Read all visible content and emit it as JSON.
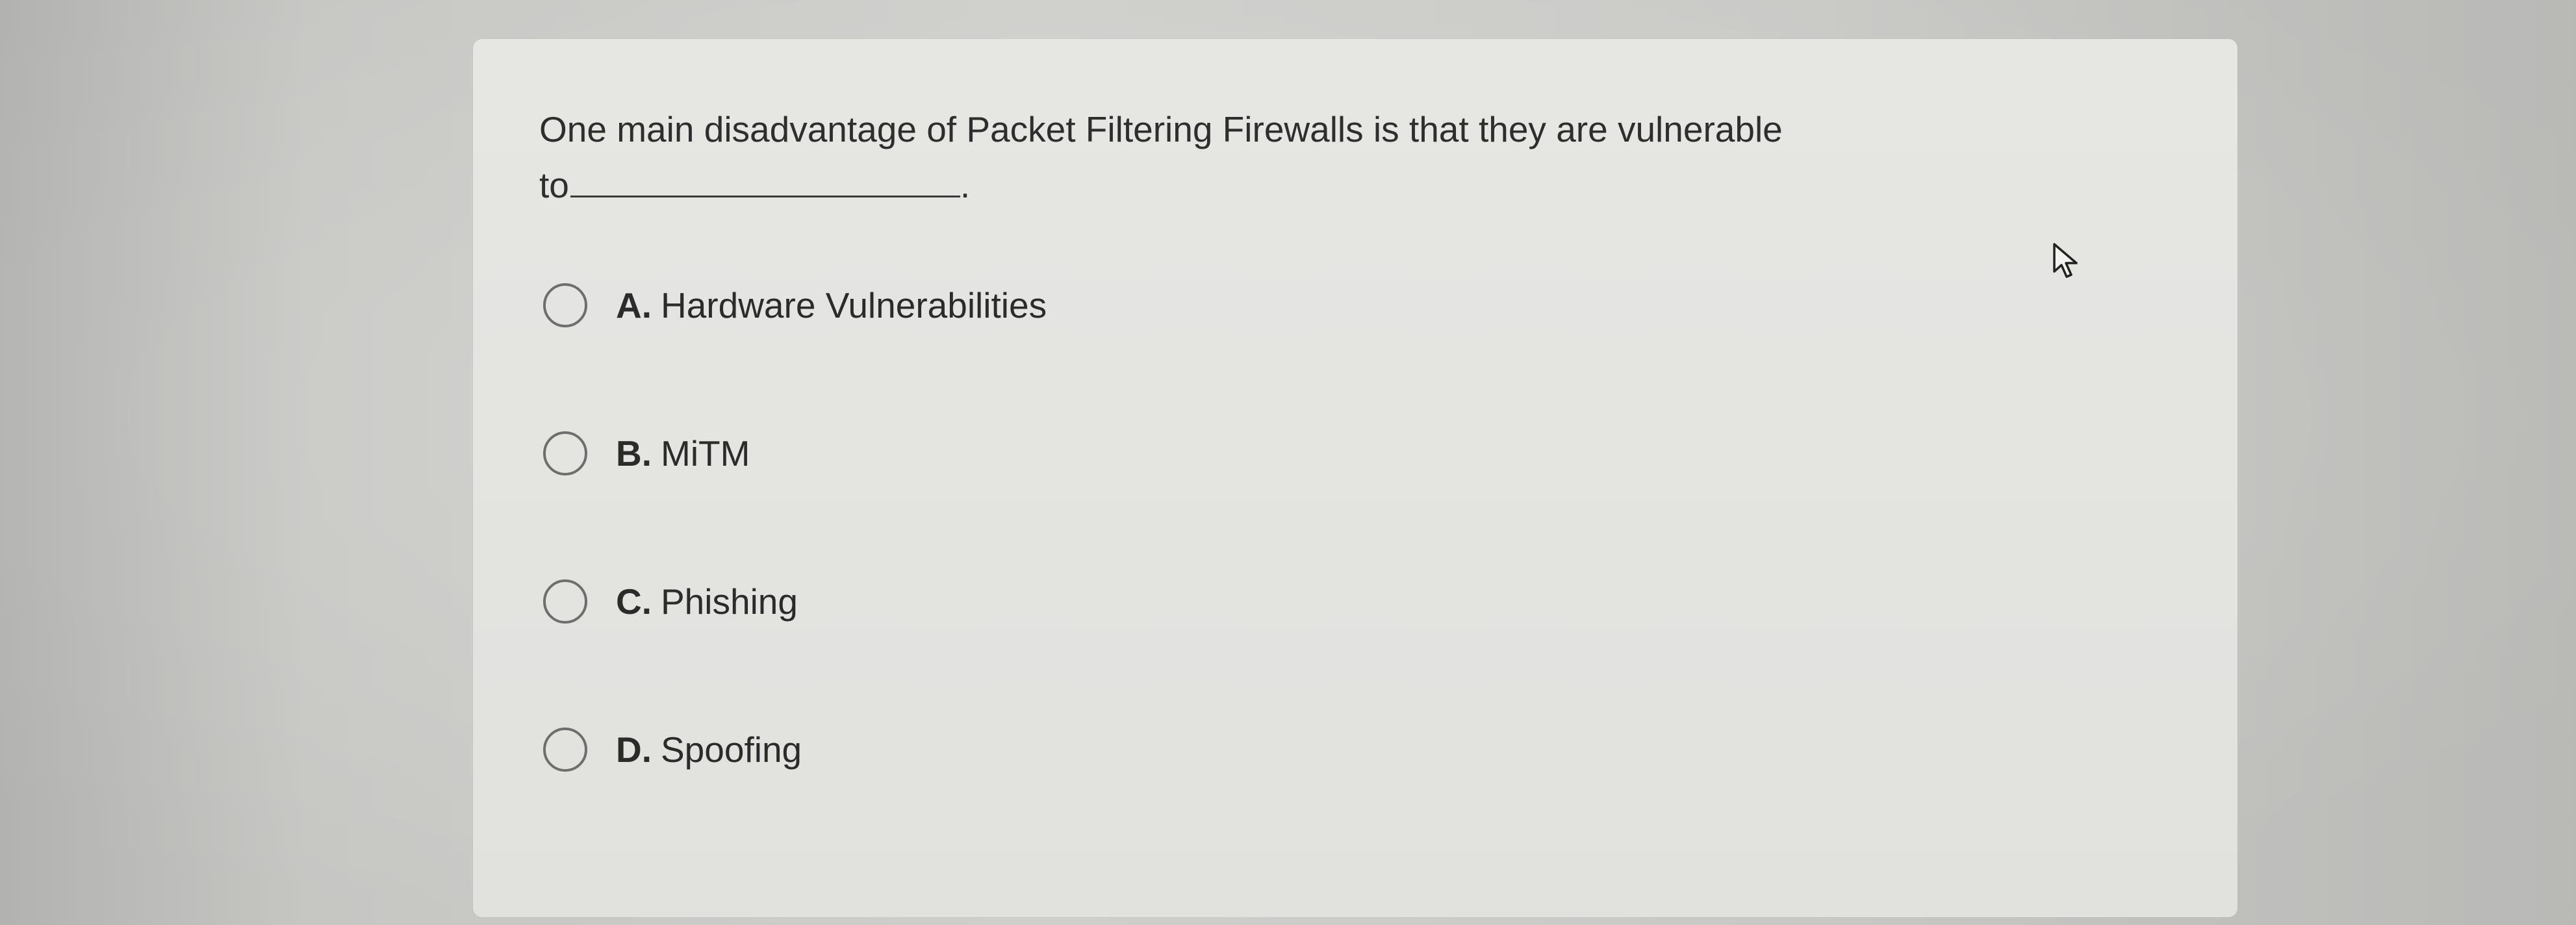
{
  "question": {
    "text_line1": "One main disadvantage of Packet Filtering Firewalls is that they are vulnerable",
    "text_line2_prefix": "to",
    "text_line2_suffix": "."
  },
  "options": [
    {
      "letter": "A.",
      "text": "Hardware Vulnerabilities",
      "selected": false
    },
    {
      "letter": "B.",
      "text": "MiTM",
      "selected": false
    },
    {
      "letter": "C.",
      "text": "Phishing",
      "selected": false
    },
    {
      "letter": "D.",
      "text": "Spoofing",
      "selected": false
    }
  ],
  "icons": {
    "cursor": "mouse-pointer-icon",
    "radio": "radio-button-icon"
  },
  "colors": {
    "page_background": "#d6d6d3",
    "card_background": "#e4e4e1",
    "text": "#2b2b2b",
    "radio_border": "#6e6e6e"
  }
}
